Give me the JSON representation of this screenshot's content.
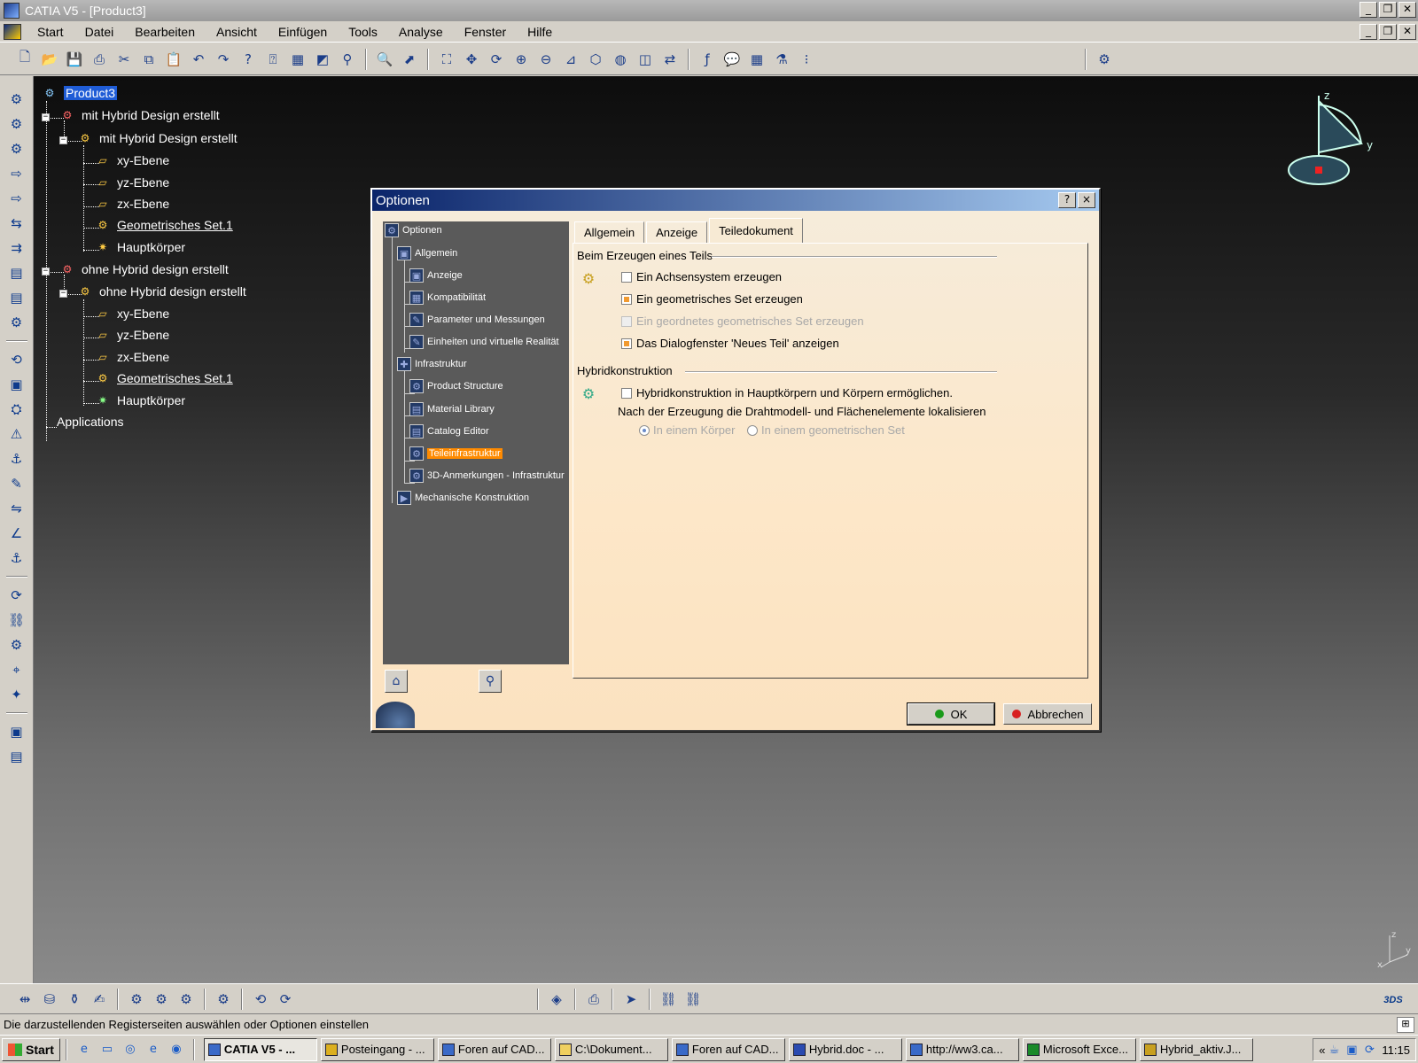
{
  "window": {
    "title": "CATIA V5 - [Product3]"
  },
  "menu": [
    "Start",
    "Datei",
    "Bearbeiten",
    "Ansicht",
    "Einfügen",
    "Tools",
    "Analyse",
    "Fenster",
    "Hilfe"
  ],
  "tree": {
    "root": "Product3",
    "part1": "mit Hybrid Design erstellt",
    "part1_body": "mit Hybrid Design erstellt",
    "part2": "ohne Hybrid design erstellt",
    "part2_body": "ohne Hybrid design erstellt",
    "xy": "xy-Ebene",
    "yz": "yz-Ebene",
    "zx": "zx-Ebene",
    "geoset": "Geometrisches Set.1",
    "body": "Hauptkörper",
    "applications": "Applications"
  },
  "dialog": {
    "title": "Optionen",
    "help_btn": "?",
    "close_btn": "×",
    "tree": {
      "options": "Optionen",
      "general": "Allgemein",
      "display": "Anzeige",
      "compat": "Kompatibilität",
      "params": "Parameter und Messungen",
      "units": "Einheiten und virtuelle Realität",
      "infra": "Infrastruktur",
      "product_structure": "Product Structure",
      "material_library": "Material Library",
      "catalog_editor": "Catalog Editor",
      "part_infra": "Teileinfrastruktur",
      "annotations": "3D-Anmerkungen - Infrastruktur",
      "mech": "Mechanische Konstruktion"
    },
    "tabs": [
      "Allgemein",
      "Anzeige",
      "Teiledokument"
    ],
    "group1": {
      "title": "Beim Erzeugen eines Teils",
      "opt1": "Ein Achsensystem erzeugen",
      "opt2": "Ein geometrisches Set erzeugen",
      "opt3": "Ein geordnetes geometrisches Set erzeugen",
      "opt4": "Das Dialogfenster 'Neues Teil' anzeigen",
      "checked": [
        false,
        true,
        false,
        true
      ]
    },
    "group2": {
      "title": "Hybridkonstruktion",
      "opt1": "Hybridkonstruktion in Hauptkörpern und Körpern ermöglichen.",
      "note": "Nach der Erzeugung die Drahtmodell- und Flächenelemente lokalisieren",
      "radio1": "In einem Körper",
      "radio2": "In einem geometrischen Set"
    },
    "ok": "OK",
    "cancel": "Abbrechen"
  },
  "compass": {
    "z": "z",
    "y": "y",
    "x": "x"
  },
  "status": "Die darzustellenden Registerseiten auswählen oder Optionen einstellen",
  "taskbar": {
    "start": "Start",
    "tasks": [
      "CATIA V5 - ...",
      "Posteingang - ...",
      "Foren auf CAD...",
      "C:\\Dokument...",
      "Foren auf CAD...",
      "Hybrid.doc - ...",
      "http://ww3.ca...",
      "Microsoft Exce...",
      "Hybrid_aktiv.J..."
    ],
    "chevron": "«",
    "clock": "11:15"
  }
}
